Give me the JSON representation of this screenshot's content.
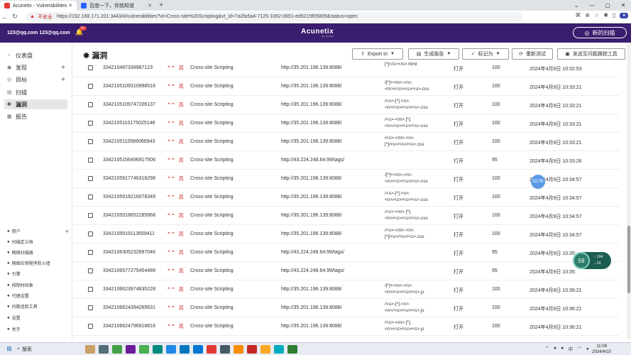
{
  "browser": {
    "tabs": [
      {
        "label": "Acunetix - Vulnerabilities",
        "active": true
      },
      {
        "label": "百度一下，你就知道",
        "active": false
      }
    ],
    "insecure_label": "不安全",
    "url": "https://192.168.171.201:3443/#/vulnerabilities?vt=Cross-site%20Scripting&vt_id=7a2fa5a4-7125-1062-0651-ed5219f05809&status=open"
  },
  "header": {
    "user": "123@qq.com 123@qq.com",
    "notification_count": "9+",
    "logo": "Acunetix",
    "logo_sub": "by Invicti",
    "new_scan_label": "新的扫描"
  },
  "sidebar": {
    "items": [
      {
        "label": "仪表盘",
        "icon": "dashboard-icon",
        "plus": false
      },
      {
        "label": "发现",
        "icon": "discovery-icon",
        "plus": true
      },
      {
        "label": "目标",
        "icon": "target-icon",
        "plus": true
      },
      {
        "label": "扫描",
        "icon": "scan-icon",
        "plus": false
      },
      {
        "label": "漏洞",
        "icon": "bug-icon",
        "plus": false,
        "active": true
      },
      {
        "label": "报告",
        "icon": "report-icon",
        "plus": false
      }
    ],
    "bottom_items": [
      {
        "label": "用户",
        "plus": true
      },
      {
        "label": "扫描定义档",
        "plus": false
      },
      {
        "label": "网络扫描器",
        "plus": false
      },
      {
        "label": "网络应用程序防火墙",
        "plus": false
      },
      {
        "label": "引擎",
        "plus": false
      },
      {
        "label": "排除时间表",
        "plus": false
      },
      {
        "label": "代理设置",
        "plus": false
      },
      {
        "label": "问题追踪工具",
        "plus": false
      },
      {
        "label": "设置",
        "plus": false
      },
      {
        "label": "关于",
        "plus": false
      }
    ]
  },
  "page": {
    "title": "漏洞",
    "buttons": {
      "export": "Export to",
      "report": "生成报告",
      "mark_as": "标记为",
      "retest": "重新测试",
      "send_to_tracker": "发送至问题跟踪工具"
    }
  },
  "rows": [
    {
      "id": "33421048733898​71​23",
      "severity": "高",
      "name": "Cross-site Scripting",
      "url": "http://35.201.196.139:8088/",
      "param": [
        "[*]</s></s>.html"
      ],
      "status": "打开",
      "confidence": "100",
      "date": "2024年4月9日 10:32:53"
    },
    {
      "id": "3342105109310998518",
      "severity": "高",
      "name": "Cross-site Scripting",
      "url": "http://35.201.196.139:8088/",
      "param": [
        "/[*]+<m>.<n>.",
        "<m>/<s>/<s>/<s>.css"
      ],
      "status": "打开",
      "confidence": "100",
      "date": "2024年4月9日 10:33:21"
    },
    {
      "id": "3342105109747206137",
      "severity": "高",
      "name": "Cross-site Scripting",
      "url": "http://35.201.196.139:8088/",
      "param": [
        "/<s>-[*].<n>.",
        "<n>/<s>/<s>/<s>.css"
      ],
      "status": "打开",
      "confidence": "100",
      "date": "2024年4月9日 10:33:21"
    },
    {
      "id": "3342105110175025148",
      "severity": "高",
      "name": "Cross-site Scripting",
      "url": "http://35.201.196.139:8088/",
      "param": [
        "/<s>-<m>.[*].",
        "<n>/<s>/<s>/<s>.css"
      ],
      "status": "打开",
      "confidence": "100",
      "date": "2024年4月9日 10:33:21"
    },
    {
      "id": "3342105110586066943",
      "severity": "高",
      "name": "Cross-site Scripting",
      "url": "http://35.201.196.139:8088/",
      "param": [
        "/<s>-<m>.<n>.",
        "[*]/<s>/<s>/<s>.css"
      ],
      "status": "打开",
      "confidence": "100",
      "date": "2024年4月9日 10:33:21"
    },
    {
      "id": "3342105156496917506",
      "severity": "高",
      "name": "Cross-site Scripting",
      "url": "http://43.224.248.64:99/tags/",
      "param": [],
      "status": "打开",
      "confidence": "95",
      "date": "2024年4月9日 10:33:26"
    },
    {
      "id": "3342105917746316298",
      "severity": "高",
      "name": "Cross-site Scripting",
      "url": "http://35.201.196.139:8088/",
      "param": [
        "/[*]+<m>.<n>.",
        "<n>/<s>/<s>/<s>.css"
      ],
      "status": "打开",
      "confidence": "100",
      "date": "2024年4月9日 10:34:57"
    },
    {
      "id": "3342105918216078349",
      "severity": "高",
      "name": "Cross-site Scripting",
      "url": "http://35.201.196.139:8088/",
      "param": [
        "/<s>-[*].<n>.",
        "<n>/<s>/<s>/<s>.css"
      ],
      "status": "打开",
      "confidence": "100",
      "date": "2024年4月9日 10:34:57"
    },
    {
      "id": "3342105918652285968",
      "severity": "高",
      "name": "Cross-site Scripting",
      "url": "http://35.201.196.139:8088/",
      "param": [
        "/<s>-<m>.[*].",
        "<n>/<s>/<s>/<s>.css"
      ],
      "status": "打开",
      "confidence": "100",
      "date": "2024年4月9日 10:34:57"
    },
    {
      "id": "3342105919113659411",
      "severity": "高",
      "name": "Cross-site Scripting",
      "url": "http://35.201.196.139:8088/",
      "param": [
        "/<s>-<m>.<n>.",
        "[*]/<s>/<s>/<s>.css"
      ],
      "status": "打开",
      "confidence": "100",
      "date": "2024年4月9日 10:34:57"
    },
    {
      "id": "3342106305232897046",
      "severity": "高",
      "name": "Cross-site Scripting",
      "url": "http://43.224.248.64:99/tags/",
      "param": [],
      "status": "打开",
      "confidence": "95",
      "date": "2024年4月9日 10:35:"
    },
    {
      "id": "3342106577275454489",
      "severity": "高",
      "name": "Cross-site Scripting",
      "url": "http://43.224.248.64:99/tags/",
      "param": [],
      "status": "打开",
      "confidence": "95",
      "date": "2024年4月9日 10:35:"
    },
    {
      "id": "3342106623974835228",
      "severity": "高",
      "name": "Cross-site Scripting",
      "url": "http://35.201.196.139:8088/",
      "param": [
        "/[*]+<m>.<n>.",
        "<n>/<s>/<s>/<s>.js"
      ],
      "status": "打开",
      "confidence": "100",
      "date": "2024年4月9日 10:36:21"
    },
    {
      "id": "3342106624394265631",
      "severity": "高",
      "name": "Cross-site Scripting",
      "url": "http://35.201.196.139:8088/",
      "param": [
        "/<s>-[*].<n>.",
        "<n>/<s>/<s>/<s>.js"
      ],
      "status": "打开",
      "confidence": "100",
      "date": "2024年4月9日 10:36:21"
    },
    {
      "id": "3342106624796918818",
      "severity": "高",
      "name": "Cross-site Scripting",
      "url": "http://35.201.196.139:8088/",
      "param": [
        "/<s>-<m>.[*].",
        "<n>/<s>/<s>/<s>.js"
      ],
      "status": "打开",
      "confidence": "100",
      "date": "2024年4月9日 10:36:21"
    }
  ],
  "overlay": {
    "timer_bubble": "02:05",
    "gauge_value": "59",
    "gauge_up": "104",
    "gauge_down": "23"
  },
  "taskbar": {
    "search_label": "搜索",
    "time": "11:08",
    "date": "2024/4/10"
  }
}
